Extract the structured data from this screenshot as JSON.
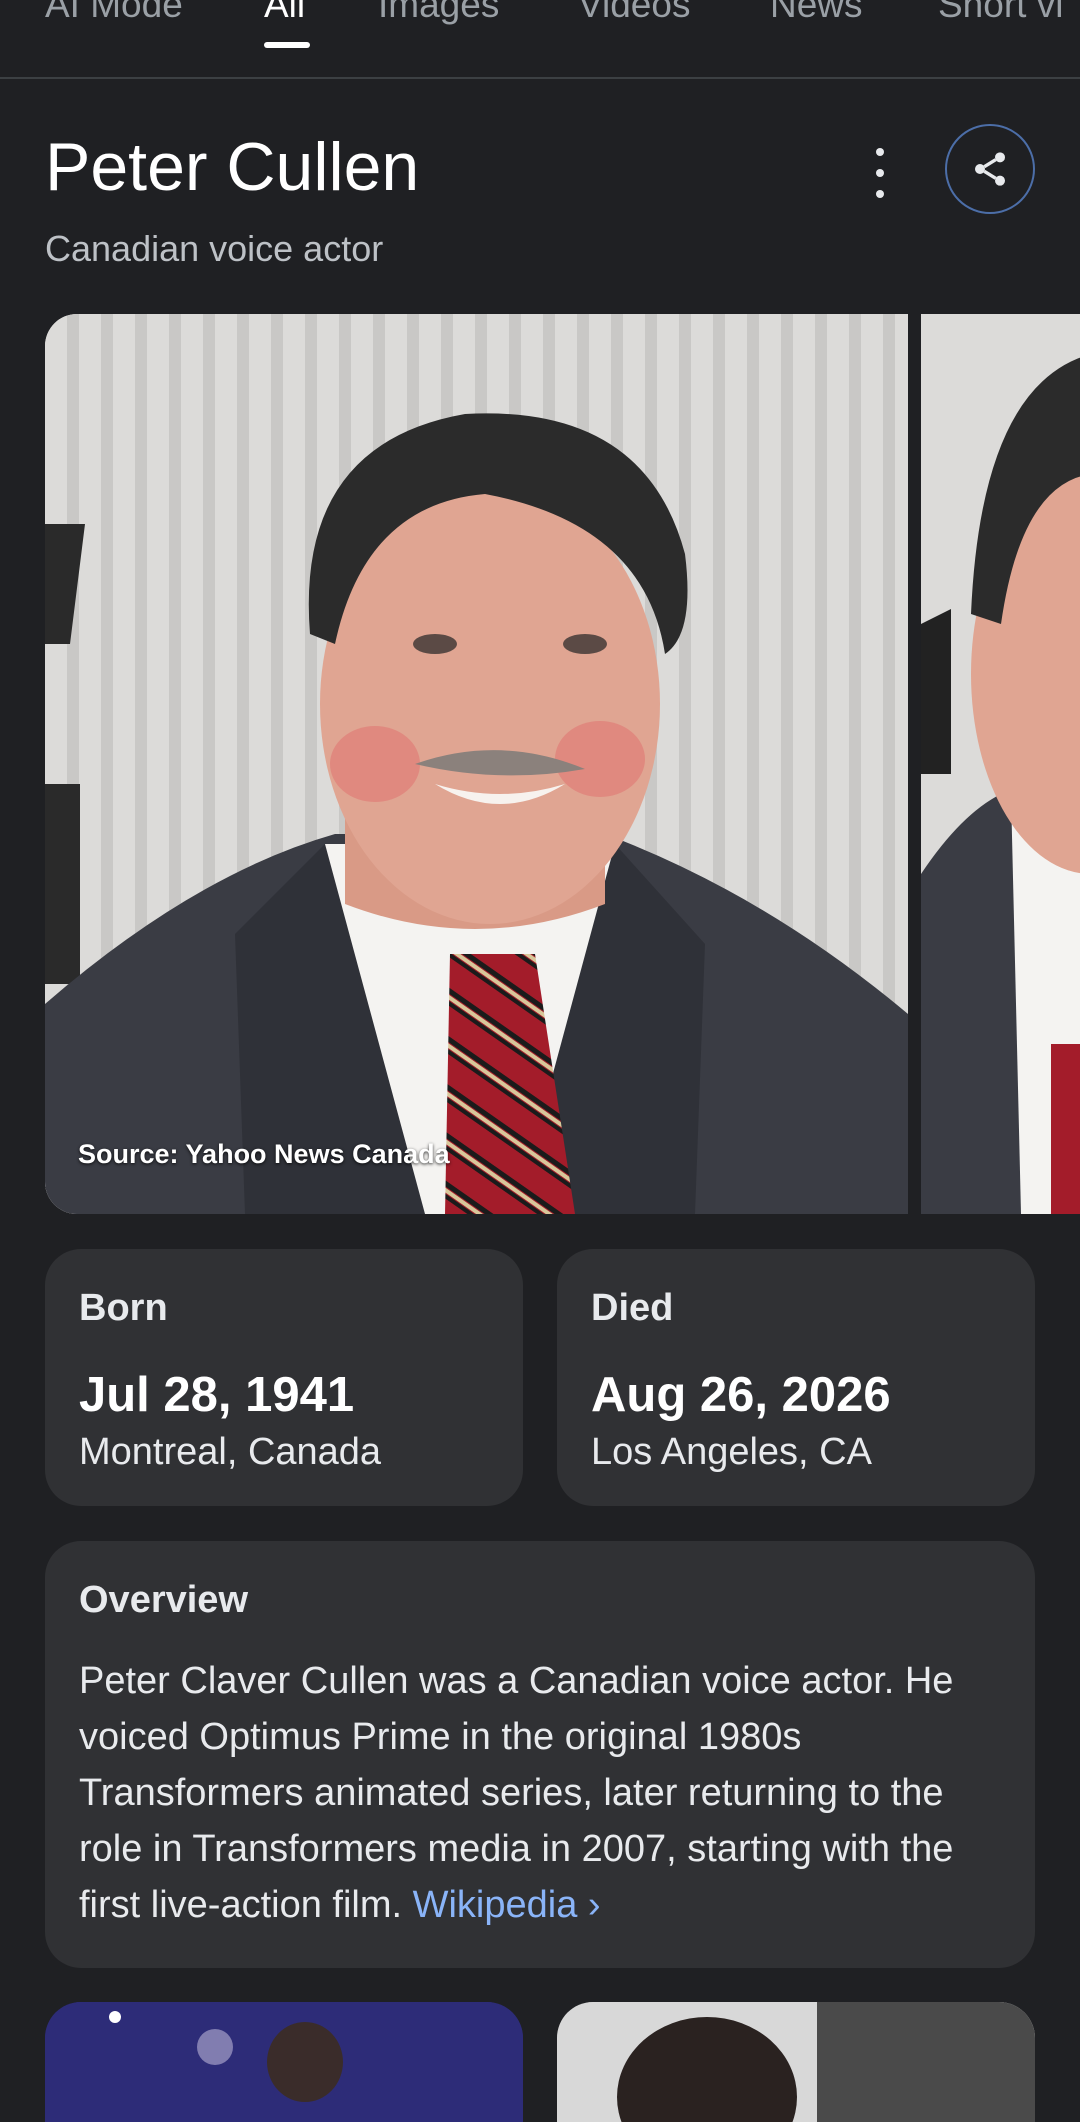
{
  "tabs": [
    {
      "label": "AI Mode"
    },
    {
      "label": "All"
    },
    {
      "label": "Images"
    },
    {
      "label": "Videos"
    },
    {
      "label": "News"
    },
    {
      "label": "Short vi"
    }
  ],
  "active_tab": "All",
  "entity": {
    "name": "Peter Cullen",
    "description": "Canadian voice actor"
  },
  "image": {
    "source": "Source: Yahoo News Canada"
  },
  "facts": {
    "born": {
      "label": "Born",
      "date": "Jul 28, 1941",
      "place": "Montreal, Canada"
    },
    "died": {
      "label": "Died",
      "date": "Aug 26, 2026",
      "place": "Los Angeles, CA"
    }
  },
  "overview": {
    "label": "Overview",
    "text": "Peter Claver Cullen was a Canadian voice actor. He voiced Optimus Prime in the original 1980s Transformers animated series, later returning to the role in Transformers media in 2007, starting with the first live-action film. ",
    "link": "Wikipedia",
    "link_chevron": "›"
  },
  "icons": {
    "more": "more-vert-icon",
    "share": "share-icon"
  },
  "colors": {
    "background": "#1f2023",
    "card": "#303134",
    "link": "#8ab4f8",
    "share_border": "#4c6ea8"
  }
}
